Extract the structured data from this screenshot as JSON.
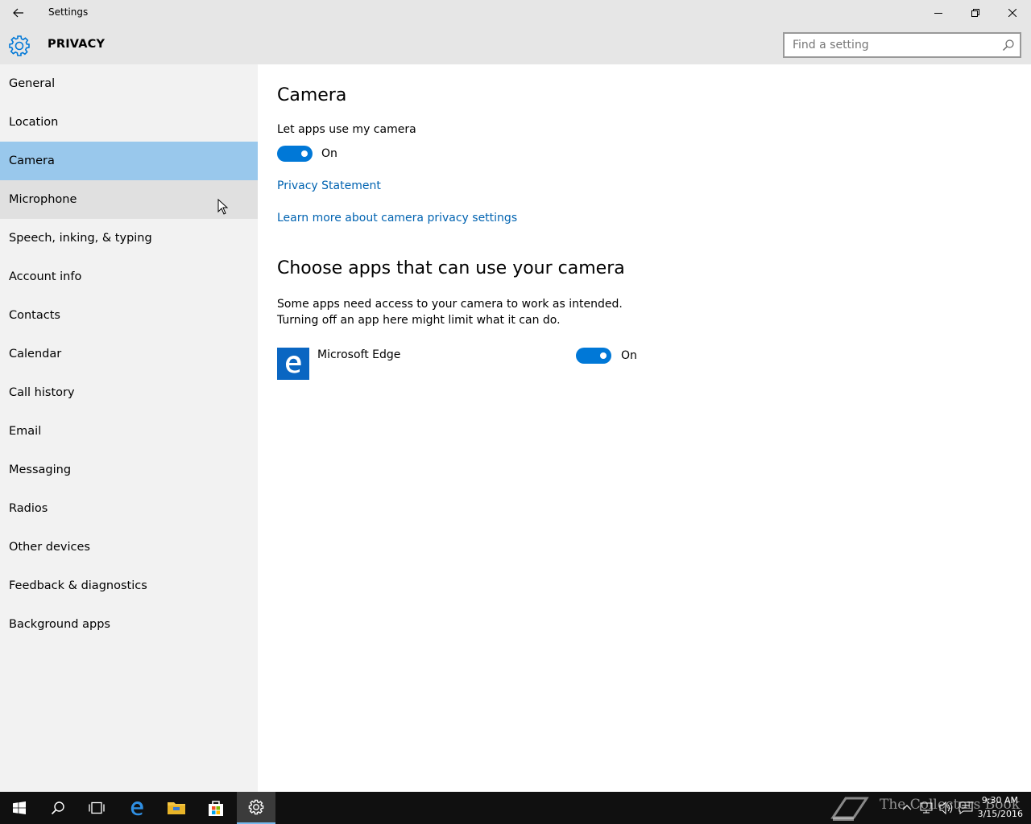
{
  "window": {
    "title": "Settings"
  },
  "header": {
    "section": "PRIVACY",
    "search_placeholder": "Find a setting"
  },
  "sidebar": {
    "items": [
      {
        "label": "General"
      },
      {
        "label": "Location"
      },
      {
        "label": "Camera",
        "selected": true
      },
      {
        "label": "Microphone",
        "hover": true
      },
      {
        "label": "Speech, inking, & typing"
      },
      {
        "label": "Account info"
      },
      {
        "label": "Contacts"
      },
      {
        "label": "Calendar"
      },
      {
        "label": "Call history"
      },
      {
        "label": "Email"
      },
      {
        "label": "Messaging"
      },
      {
        "label": "Radios"
      },
      {
        "label": "Other devices"
      },
      {
        "label": "Feedback & diagnostics"
      },
      {
        "label": "Background apps"
      }
    ]
  },
  "main": {
    "title": "Camera",
    "camera_toggle_label": "Let apps use my camera",
    "camera_toggle_state": "On",
    "privacy_link": "Privacy Statement",
    "learn_more_link": "Learn more about camera privacy settings",
    "apps_heading": "Choose apps that can use your camera",
    "apps_desc_line1": "Some apps need access to your camera to work as intended.",
    "apps_desc_line2": "Turning off an app here might limit what it can do.",
    "apps": [
      {
        "name": "Microsoft Edge",
        "state": "On",
        "icon": "edge-icon"
      }
    ]
  },
  "taskbar": {
    "time": "9:30 AM",
    "date": "3/15/2016",
    "watermark": "The Collectors Book"
  },
  "colors": {
    "accent": "#0078d7",
    "selected_nav": "#99c8ec",
    "link": "#0063b1",
    "sidebar_bg": "#f2f2f2",
    "titlebar_bg": "#e6e6e6",
    "taskbar_bg": "#101010"
  }
}
